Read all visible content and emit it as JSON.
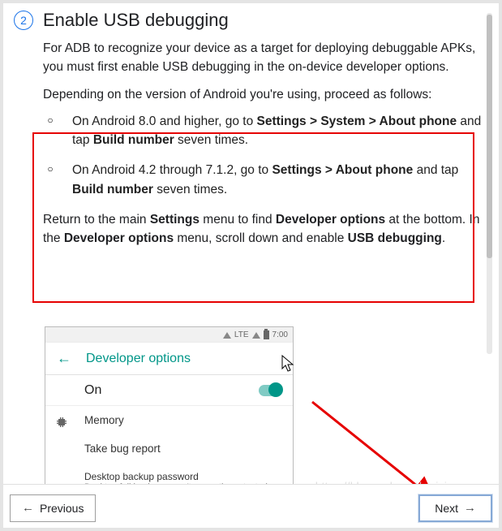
{
  "step": {
    "number": "2",
    "heading": "Enable USB debugging"
  },
  "para1": "For ADB to recognize your device as a target for deploying debuggable APKs, you must first enable USB debugging in the on-device developer options.",
  "para2": "Depending on the version of Android you're using, proceed as follows:",
  "bullets": [
    {
      "pre": "On Android 8.0 and higher, go to ",
      "s1": "Settings > System > About phone",
      "mid": " and tap ",
      "s2": "Build number",
      "post": " seven times."
    },
    {
      "pre": "On Android 4.2 through 7.1.2, go to ",
      "s1": "Settings > About phone",
      "mid": " and tap ",
      "s2": "Build number",
      "post": " seven times."
    }
  ],
  "para3": {
    "a": "Return to the main ",
    "b": "Settings",
    "c": " menu to find ",
    "d": "Developer options",
    "e": " at the bottom. In the ",
    "f": "Developer options",
    "g": " menu, scroll down and enable ",
    "h": "USB debugging",
    "i": "."
  },
  "phone": {
    "status_lte": "LTE",
    "status_time": "7:00",
    "title": "Developer options",
    "on": "On",
    "memory": "Memory",
    "bugreport": "Take bug report",
    "dbp_title": "Desktop backup password",
    "dbp_sub": "Desktop full backups aren't currently protected"
  },
  "footer": {
    "prev": "Previous",
    "next": "Next"
  },
  "watermark": "https://blog.csdn.net/weixin_..."
}
